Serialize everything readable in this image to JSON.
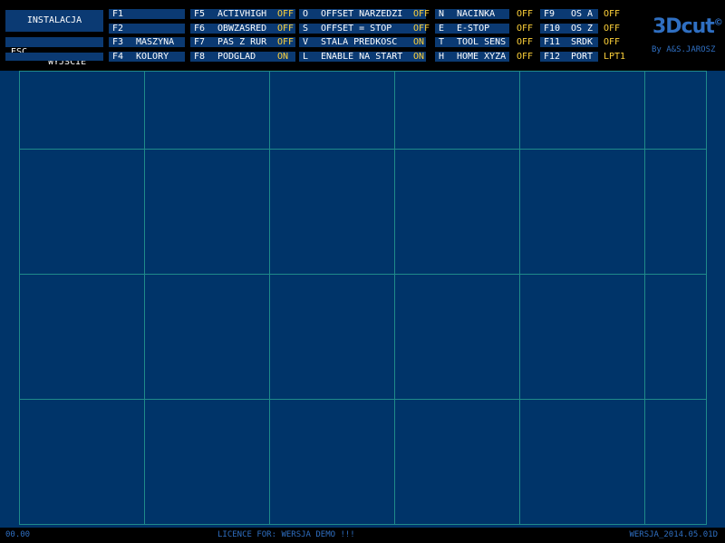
{
  "app": {
    "logo": "3Dcut",
    "logo_mark": "©",
    "by_line": "By A&S.JAROSZ"
  },
  "left_buttons": {
    "instalacja": "INSTALACJA",
    "esc_key": "ESC",
    "esc_label": "WYJSCIE"
  },
  "columns": [
    [
      {
        "key": "F1",
        "label": "",
        "value": ""
      },
      {
        "key": "F2",
        "label": "",
        "value": ""
      },
      {
        "key": "F3",
        "label": "MASZYNA",
        "value": ""
      },
      {
        "key": "F4",
        "label": "KOLORY",
        "value": ""
      }
    ],
    [
      {
        "key": "F5",
        "label": "ACTIVHIGH",
        "value": "OFF"
      },
      {
        "key": "F6",
        "label": "OBWZASRED",
        "value": "OFF"
      },
      {
        "key": "F7",
        "label": "PAS Z RUR",
        "value": "OFF"
      },
      {
        "key": "F8",
        "label": "PODGLAD",
        "value": "ON"
      }
    ],
    [
      {
        "key": "O",
        "label": "OFFSET NARZEDZI",
        "value": "OFF"
      },
      {
        "key": "S",
        "label": "OFFSET = STOP",
        "value": "OFF"
      },
      {
        "key": "V",
        "label": "STALA PREDKOSC",
        "value": "ON"
      },
      {
        "key": "L",
        "label": "ENABLE NA START",
        "value": "ON"
      }
    ],
    [
      {
        "key": "N",
        "label": "NACINKA",
        "value": "OFF"
      },
      {
        "key": "E",
        "label": "E-STOP",
        "value": "OFF"
      },
      {
        "key": "T",
        "label": "TOOL SENS",
        "value": "OFF"
      },
      {
        "key": "H",
        "label": "HOME XYZA",
        "value": "OFF"
      }
    ],
    [
      {
        "key": "F9",
        "label": "OS A",
        "value": "OFF"
      },
      {
        "key": "F10",
        "label": "OS Z",
        "value": "OFF"
      },
      {
        "key": "F11",
        "label": "SRDK",
        "value": "OFF"
      },
      {
        "key": "F12",
        "label": "PORT",
        "value": "LPT1"
      }
    ]
  ],
  "footer": {
    "left": "00.00",
    "center": "LICENCE FOR: WERSJA DEMO !!!",
    "right": "WERSJA_2014.05.01D"
  },
  "colors": {
    "panel": "#0b3a73",
    "workspace": "#003469",
    "grid": "#1f8a8a",
    "value": "#ffd23a",
    "logo": "#2f6fc2"
  }
}
